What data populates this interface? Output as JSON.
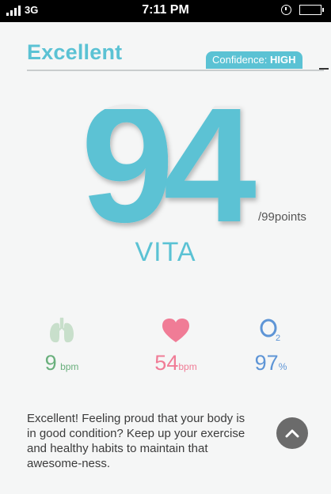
{
  "status_bar": {
    "carrier": "3G",
    "time": "7:11 PM",
    "icons": [
      "signal-icon",
      "clock-icon",
      "battery-icon"
    ]
  },
  "header": {
    "title": "Excellent",
    "confidence_label": "Confidence:",
    "confidence_value": "HIGH"
  },
  "score": {
    "value": "94",
    "suffix": "/99points",
    "label": "VITA"
  },
  "metrics": [
    {
      "icon": "lungs-icon",
      "value": "9",
      "unit": "bpm",
      "color": "#6ab07d"
    },
    {
      "icon": "heart-icon",
      "value": "54",
      "unit": "bpm",
      "color": "#f07c96"
    },
    {
      "icon": "oxygen-icon",
      "value": "97",
      "unit": "%",
      "color": "#5e95d6"
    }
  ],
  "description": "Excellent! Feeling proud that your body is in good condition? Keep up your exercise and healthy habits to maintain that awesome-ness.",
  "colors": {
    "accent": "#5bc2d4",
    "background": "#f5f6f6",
    "status_bar": "#000000",
    "button": "#6b6b6b"
  },
  "buttons": {
    "up": "chevron-up-icon"
  }
}
